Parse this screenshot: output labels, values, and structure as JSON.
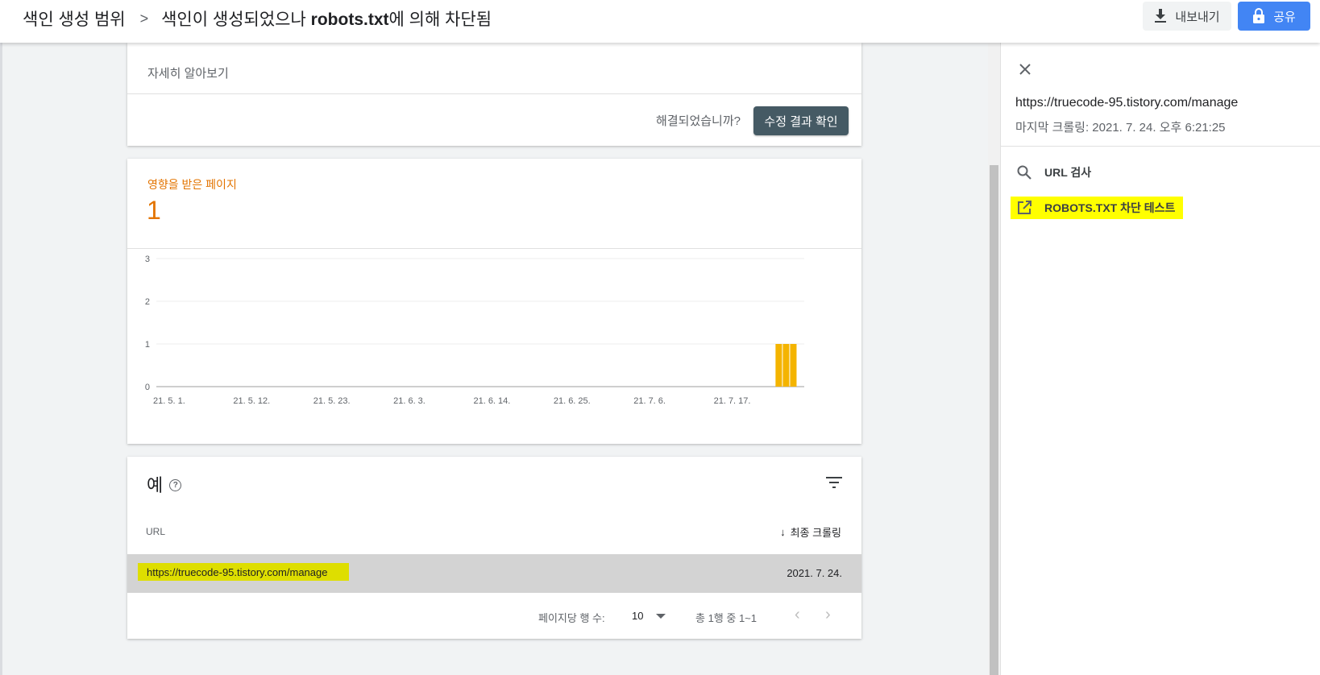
{
  "header": {
    "breadcrumb_root": "색인 생성 범위",
    "breadcrumb_sep": ">",
    "breadcrumb_current_pre": "색인이 생성되었으나 ",
    "breadcrumb_current_bold": "robots.txt",
    "breadcrumb_current_post": "에 의해 차단됨",
    "export_label": "내보내기",
    "share_label": "공유"
  },
  "details_card": {
    "learn_more": "자세히 알아보기",
    "resolved_question": "해결되었습니까?",
    "validate_label": "수정 결과 확인"
  },
  "affected": {
    "label": "영향을 받은 페이지",
    "count": "1"
  },
  "chart_data": {
    "type": "bar",
    "title": "",
    "xlabel": "",
    "ylabel": "",
    "ylim": [
      0,
      3
    ],
    "y_ticks": [
      "0",
      "1",
      "2",
      "3"
    ],
    "x_tick_labels": [
      "21. 5. 1.",
      "21. 5. 12.",
      "21. 5. 23.",
      "21. 6. 3.",
      "21. 6. 14.",
      "21. 6. 25.",
      "21. 7. 6.",
      "21. 7. 17."
    ],
    "x_range": [
      "2021-05-01",
      "2021-07-29"
    ],
    "series": [
      {
        "values": [
          {
            "x": "2021-07-25",
            "y": 1
          },
          {
            "x": "2021-07-26",
            "y": 1
          },
          {
            "x": "2021-07-27",
            "y": 1
          }
        ]
      }
    ],
    "bar_color": "#f4b400",
    "grid": true
  },
  "examples": {
    "title": "예",
    "help_glyph": "?",
    "col_url": "URL",
    "col_last_crawl": "최종 크롤링",
    "sort_glyph": "↓",
    "rows": [
      {
        "url": "https://truecode-95.tistory.com/manage",
        "date": "2021. 7. 24."
      }
    ],
    "pager": {
      "rows_per_page_label": "페이지당 행 수:",
      "rows_per_page_value": "10",
      "range": "총 1행 중 1~1",
      "prev": "‹",
      "next": "›"
    }
  },
  "side_panel": {
    "url": "https://truecode-95.tistory.com/manage",
    "last_crawl": "마지막 크롤링: 2021. 7. 24. 오후 6:21:25",
    "items": [
      {
        "label": "URL 검사",
        "icon": "search-icon"
      },
      {
        "label": "ROBOTS.TXT 차단 테스트",
        "icon": "open-in-new-icon",
        "highlight": "#ffff00"
      }
    ]
  }
}
